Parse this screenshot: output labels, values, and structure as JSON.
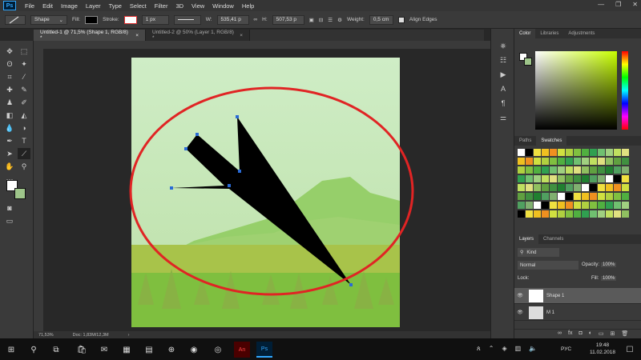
{
  "app": {
    "menu": [
      "File",
      "Edit",
      "Image",
      "Layer",
      "Type",
      "Select",
      "Filter",
      "3D",
      "View",
      "Window",
      "Help"
    ],
    "logo": "Ps"
  },
  "options": {
    "mode": "Shape",
    "fill_label": "Fill:",
    "stroke_label": "Stroke:",
    "stroke_width": "1 px",
    "w_label": "W:",
    "w_value": "535,41 p",
    "h_label": "H:",
    "h_value": "507,53 p",
    "weight_label": "Weight:",
    "weight_value": "0,5 cm",
    "align_edges": "Align Edges",
    "fill_color": "#000000",
    "stroke_color": "#e03030"
  },
  "tabs": [
    {
      "label": "Untitled-1 @ 71,5% (Shape 1, RGB/8) *",
      "close": "×"
    },
    {
      "label": "Untitled-2 @ 50% (Layer 1, RGB/8) *",
      "close": "×"
    }
  ],
  "status": {
    "zoom": "71,53%",
    "doc": "Doc: 1,83M/12,3M"
  },
  "panels": {
    "color_tabs": [
      "Color",
      "Libraries",
      "Adjustments"
    ],
    "swatch_tabs": [
      "Paths",
      "Swatches"
    ],
    "layers_tabs": [
      "Layers",
      "Channels"
    ],
    "kind": "Kind",
    "blend_mode": "Normal",
    "opacity_label": "Opacity:",
    "opacity_value": "100%",
    "lock_label": "Lock:",
    "fill_label": "Fill:",
    "fill_value": "100%",
    "layers": [
      {
        "name": "Shape 1",
        "selected": true
      },
      {
        "name": "M 1",
        "selected": false
      },
      {
        "name": "",
        "selected": false
      }
    ]
  },
  "taskbar": {
    "time": "19:48",
    "date": "11.02.2018",
    "lang": "РУС"
  }
}
